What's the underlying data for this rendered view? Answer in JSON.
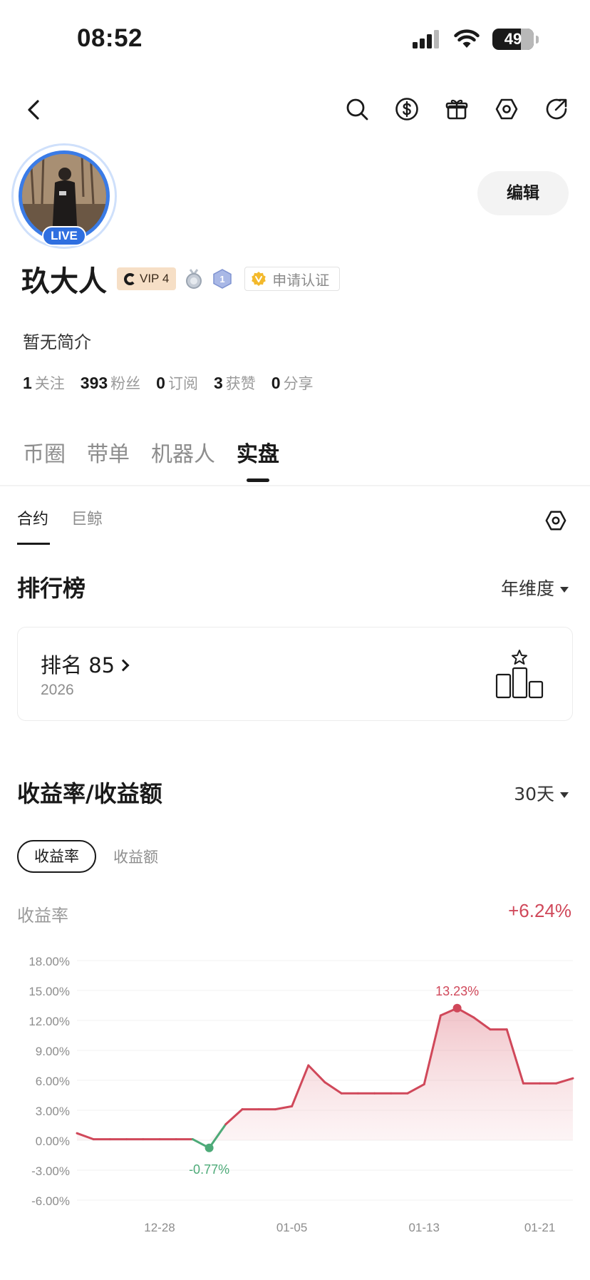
{
  "status_bar": {
    "time": "08:52",
    "battery": "49"
  },
  "profile": {
    "live_label": "LIVE",
    "edit_label": "编辑",
    "name": "玖大人",
    "vip_label": "VIP 4",
    "medal_level": "1",
    "verify_label": "申请认证",
    "bio": "暂无简介",
    "stats": [
      {
        "value": "1",
        "label": "关注"
      },
      {
        "value": "393",
        "label": "粉丝"
      },
      {
        "value": "0",
        "label": "订阅"
      },
      {
        "value": "3",
        "label": "获赞"
      },
      {
        "value": "0",
        "label": "分享"
      }
    ]
  },
  "main_tabs": [
    "币圈",
    "带单",
    "机器人",
    "实盘"
  ],
  "active_main_tab": "实盘",
  "sub_tabs": [
    "合约",
    "巨鲸"
  ],
  "active_sub_tab": "合约",
  "ranking": {
    "title": "排行榜",
    "period": "年维度",
    "rank_label": "排名 85",
    "year": "2026"
  },
  "returns": {
    "title": "收益率/收益额",
    "period": "30天",
    "tabs": [
      "收益率",
      "收益额"
    ],
    "active_tab": "收益率",
    "metric_label": "收益率",
    "metric_value": "+6.24%"
  },
  "colors": {
    "positive": "#d0485a",
    "negative": "#4daa78",
    "text": "#1a1a1a",
    "muted": "#9a9a9a"
  },
  "chart_data": {
    "type": "area",
    "y_ticks": [
      "18.00%",
      "15.00%",
      "12.00%",
      "9.00%",
      "6.00%",
      "3.00%",
      "0.00%",
      "-3.00%",
      "-6.00%"
    ],
    "x_ticks": [
      "12-28",
      "01-05",
      "01-13",
      "01-21"
    ],
    "ylim": [
      -6,
      18
    ],
    "y_unit": "%",
    "values": [
      0.7,
      0.1,
      0.1,
      0.1,
      0.1,
      0.1,
      0.1,
      0.1,
      -0.77,
      1.6,
      3.1,
      3.1,
      3.1,
      3.4,
      7.5,
      5.8,
      4.7,
      4.7,
      4.7,
      4.7,
      4.7,
      5.6,
      12.5,
      13.23,
      12.3,
      11.1,
      11.1,
      5.7,
      5.7,
      5.7,
      6.2
    ],
    "min_label": "-0.77%",
    "max_label": "13.23%",
    "grid": true,
    "legend": "none"
  }
}
